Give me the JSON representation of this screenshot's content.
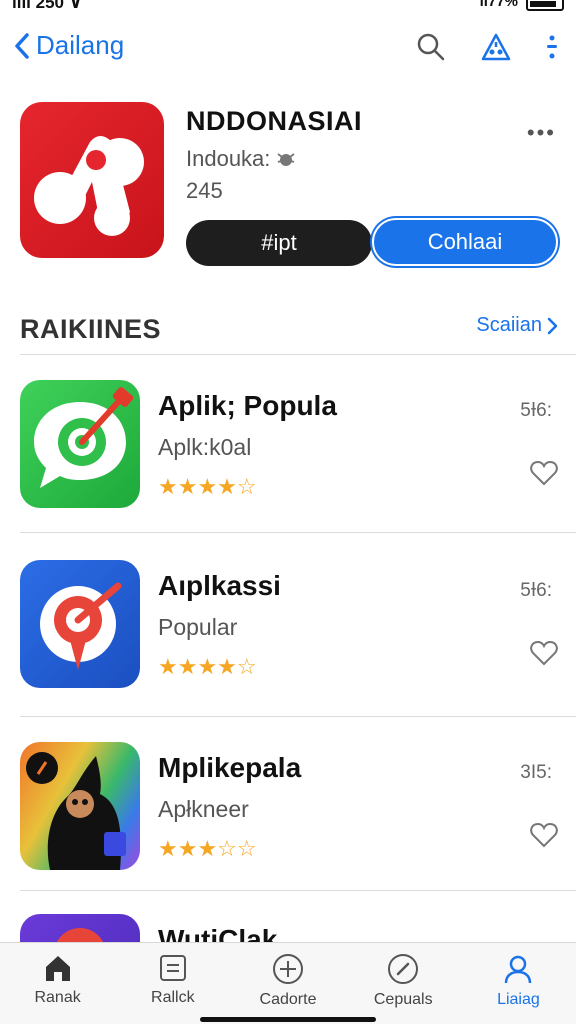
{
  "status": {
    "time": "ılıı 250 ∨",
    "battery": "ıl77%"
  },
  "nav": {
    "back_label": "Dailang"
  },
  "hero": {
    "title": "NDDONASIAI",
    "subtitle": "Indouka:",
    "count": "245",
    "primary_button": "#ipt",
    "secondary_button": "Cohlaai"
  },
  "section": {
    "title": "RAIKIINES",
    "link": "Scaiian"
  },
  "apps": [
    {
      "title": "Aplik; Popula",
      "subtitle": "Aplk:k0al",
      "meta": "5Ɨ6:",
      "rating": 3.5
    },
    {
      "title": "Aıplkassi",
      "subtitle": "Popular",
      "meta": "5Ɨ6:",
      "rating": 3.5
    },
    {
      "title": "Mplikepala",
      "subtitle": "Apłkneer",
      "meta": "3I5:",
      "rating": 3.5
    },
    {
      "title": "WutiClak",
      "subtitle": "",
      "meta": "",
      "rating": 0
    }
  ],
  "tabs": [
    {
      "label": "Ranak",
      "icon": "home-icon"
    },
    {
      "label": "Rallck",
      "icon": "document-icon"
    },
    {
      "label": "Cadorte",
      "icon": "plus-circle-icon"
    },
    {
      "label": "Cepuals",
      "icon": "search-circle-icon"
    },
    {
      "label": "Liaiag",
      "icon": "person-icon"
    }
  ],
  "colors": {
    "accent": "#1a73e8",
    "star": "#f5a623",
    "hero_icon": "#e6262e"
  }
}
